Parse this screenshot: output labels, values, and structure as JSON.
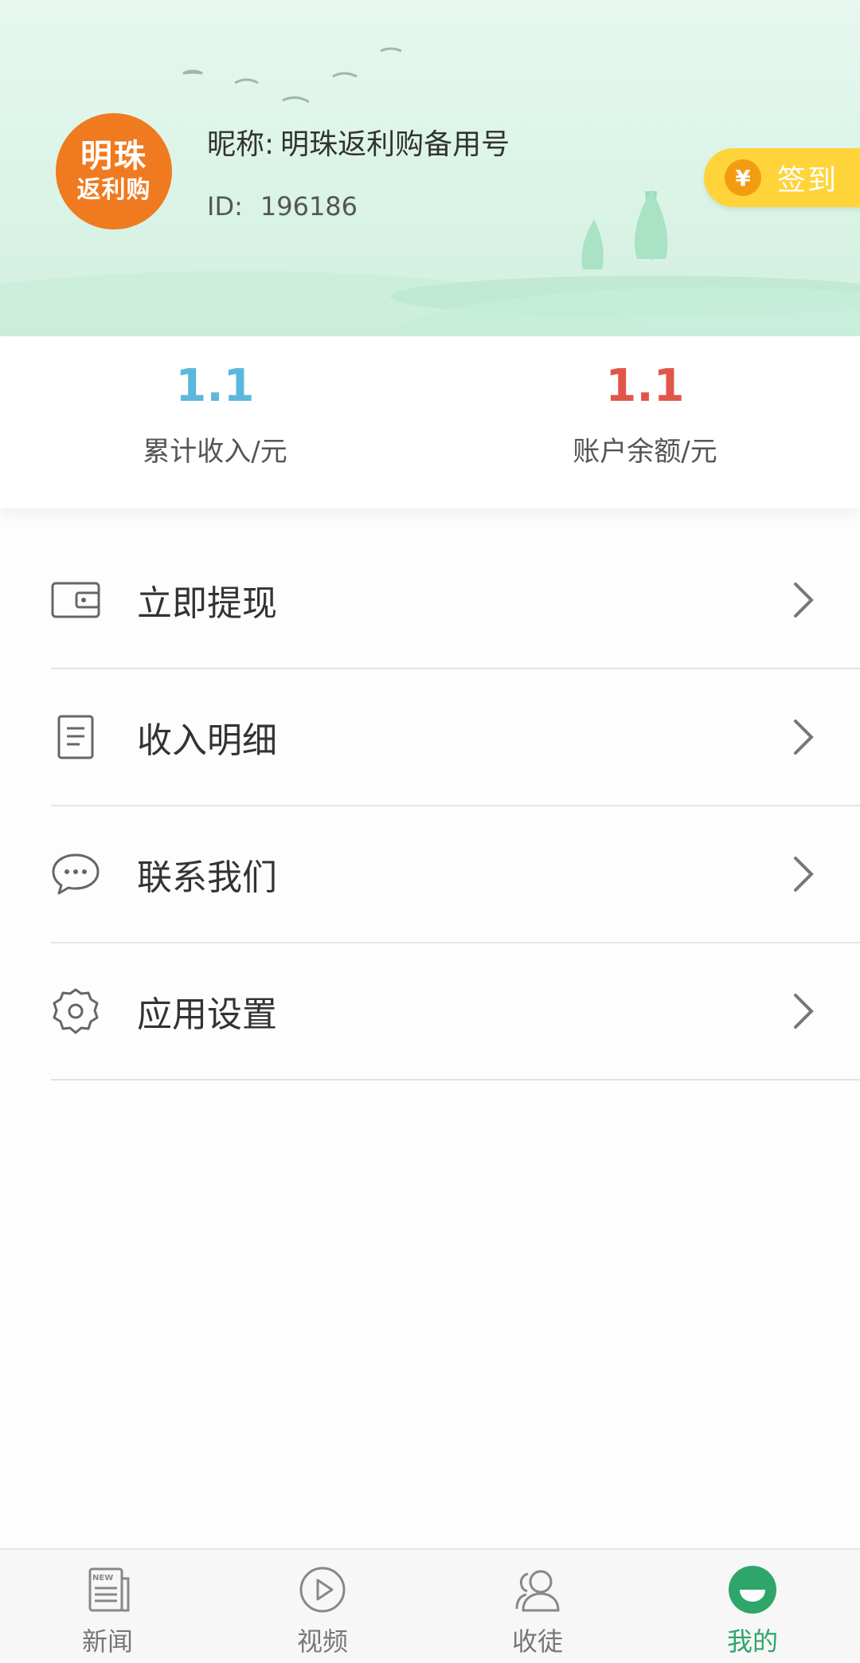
{
  "profile": {
    "avatar_line1": "明珠",
    "avatar_line2": "返利购",
    "nickname_label": "昵称:",
    "nickname": "明珠返利购备用号",
    "id_label": "ID:",
    "id_value": "196186",
    "signin_label": "签到",
    "signin_icon": "yen-coin-icon"
  },
  "stats": [
    {
      "value": "1.1",
      "label": "累计收入/元",
      "color": "#5bb8dc"
    },
    {
      "value": "1.1",
      "label": "账户余额/元",
      "color": "#e2564a"
    }
  ],
  "menu": [
    {
      "label": "立即提现",
      "icon": "wallet-icon"
    },
    {
      "label": "收入明细",
      "icon": "document-icon"
    },
    {
      "label": "联系我们",
      "icon": "chat-bubble-icon"
    },
    {
      "label": "应用设置",
      "icon": "gear-icon"
    }
  ],
  "bottom_nav": [
    {
      "label": "新闻",
      "icon": "news-icon",
      "active": false
    },
    {
      "label": "视频",
      "icon": "play-icon",
      "active": false
    },
    {
      "label": "收徒",
      "icon": "users-icon",
      "active": false
    },
    {
      "label": "我的",
      "icon": "smile-icon",
      "active": true
    }
  ],
  "colors": {
    "accent": "#2ea66a",
    "signin_bg": "#ffd43b",
    "avatar_bg": "#f07a1f"
  }
}
